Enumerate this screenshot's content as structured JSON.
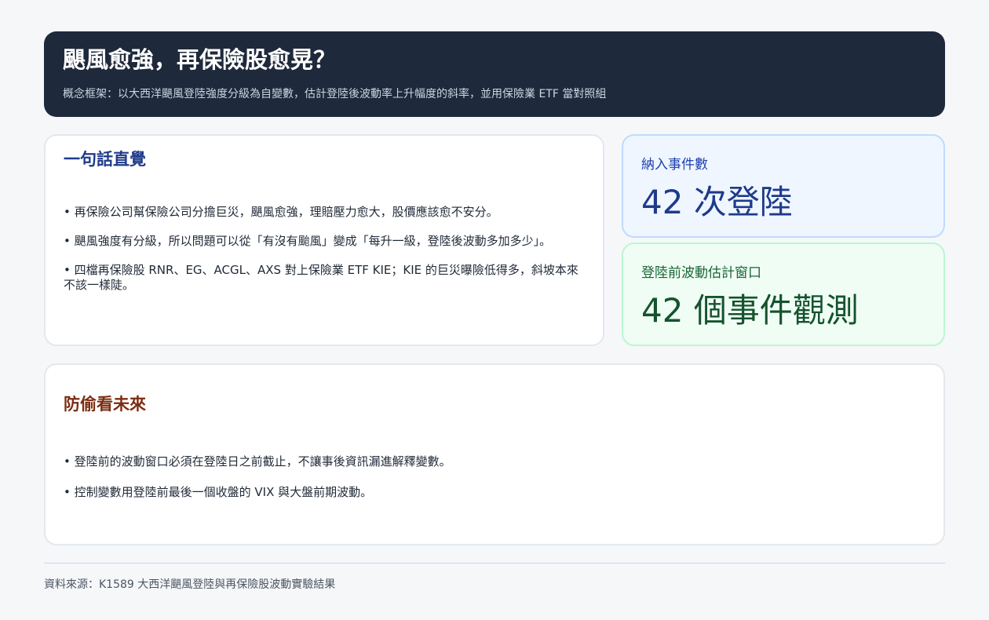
{
  "header": {
    "title": "颶風愈強，再保險股愈晃？",
    "subtitle": "概念框架：以大西洋颶風登陸強度分級為自變數，估計登陸後波動率上升幅度的斜率，並用保險業 ETF 當對照組"
  },
  "intuition": {
    "title": "一句話直覺",
    "bullets": [
      "• 再保險公司幫保險公司分擔巨災，颶風愈強，理賠壓力愈大，股價應該愈不安分。",
      "• 颶風強度有分級，所以問題可以從「有沒有颱風」變成「每升一級，登陸後波動多加多少」。",
      "• 四檔再保險股 RNR、EG、ACGL、AXS 對上保險業 ETF KIE；KIE 的巨災曝險低得多，斜坡本來不該一樣陡。"
    ]
  },
  "stats": {
    "events": {
      "label": "納入事件數",
      "value": "42 次登陸"
    },
    "window": {
      "label": "登陸前波動估計窗口",
      "value": "42 個事件觀測"
    }
  },
  "future": {
    "title": "防偷看未來",
    "bullets": [
      "• 登陸前的波動窗口必須在登陸日之前截止，不讓事後資訊漏進解釋變數。",
      "• 控制變數用登陸前最後一個收盤的 VIX 與大盤前期波動。"
    ]
  },
  "footer": {
    "source": "資料來源：K1589 大西洋颶風登陸與再保險股波動實驗結果"
  },
  "colors": {
    "header_bg": "#1e293b",
    "intuition_title": "#1e3a8a",
    "future_title": "#7c2d12",
    "stat_blue_bg": "#eff6ff",
    "stat_green_bg": "#f0fdf4"
  }
}
